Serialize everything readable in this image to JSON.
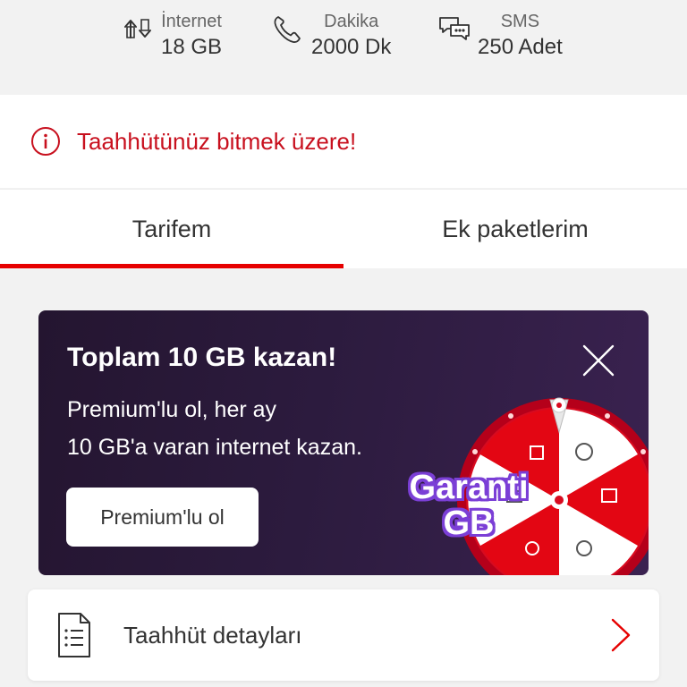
{
  "usage": [
    {
      "id": "internet",
      "label": "İnternet",
      "value": "18 GB",
      "icon": "data-transfer-icon"
    },
    {
      "id": "minutes",
      "label": "Dakika",
      "value": "2000 Dk",
      "icon": "phone-icon"
    },
    {
      "id": "sms",
      "label": "SMS",
      "value": "250 Adet",
      "icon": "chat-bubbles-icon"
    }
  ],
  "warning": {
    "text": "Taahhütünüz bitmek üzere!",
    "icon": "info-icon",
    "color": "#c8101e"
  },
  "tabs": [
    {
      "label": "Tarifem",
      "active": true
    },
    {
      "label": "Ek paketlerim",
      "active": false
    }
  ],
  "promo": {
    "title": "Toplam 10 GB kazan!",
    "description_line1": "Premium'lu ol, her ay",
    "description_line2": "10 GB'a varan internet kazan.",
    "button_label": "Premium'lu ol",
    "badge_line1": "Garanti",
    "badge_line2": "GB",
    "close_icon": "close-icon",
    "wheel_icon": "prize-wheel-icon",
    "background_color": "#2c1b3e"
  },
  "details": {
    "label": "Taahhüt detayları",
    "icon": "document-icon",
    "chevron_icon": "chevron-right-icon"
  },
  "colors": {
    "accent": "#e60000",
    "background": "#f2f2f2"
  }
}
